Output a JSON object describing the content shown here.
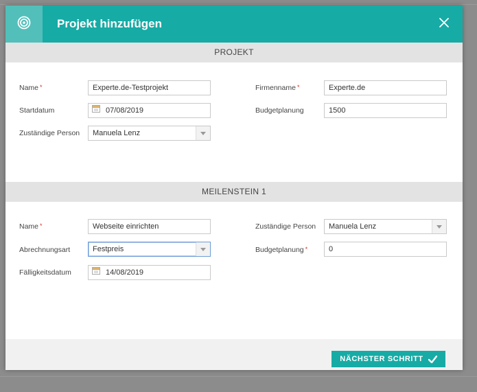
{
  "dialog": {
    "title": "Projekt hinzufügen",
    "header_icon": "target-icon",
    "close_icon": "close-icon",
    "accent_color": "#17aba5"
  },
  "project": {
    "section_title": "PROJEKT",
    "name_label": "Name",
    "name_value": "Experte.de-Testprojekt",
    "company_label": "Firmenname",
    "company_value": "Experte.de",
    "start_label": "Startdatum",
    "start_value": "07/08/2019",
    "budget_label": "Budgetplanung",
    "budget_value": "1500",
    "person_label": "Zuständige Person",
    "person_value": "Manuela Lenz"
  },
  "milestone": {
    "section_title": "MEILENSTEIN 1",
    "name_label": "Name",
    "name_value": "Webseite einrichten",
    "person_label": "Zuständige Person",
    "person_value": "Manuela Lenz",
    "billing_label": "Abrechnungsart",
    "billing_value": "Festpreis",
    "budget_label": "Budgetplanung",
    "budget_value": "0",
    "due_label": "Fälligkeitsdatum",
    "due_value": "14/08/2019"
  },
  "footer": {
    "next_label": "NÄCHSTER SCHRITT"
  },
  "required_marker": "*"
}
